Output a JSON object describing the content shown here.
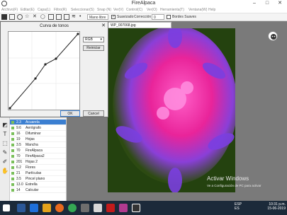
{
  "window": {
    "title": "FireAlpaca"
  },
  "menu": [
    "Archivo(F)",
    "Editar(E)",
    "Capa(L)",
    "Filtro(R)",
    "Seleccionar(S)",
    "Snap (N)",
    "Ver(V)",
    "Control(C)",
    "Ver(O)",
    "Herramienta(T)",
    "Ventana(W)",
    "Help"
  ],
  "toolbar": {
    "mode_label": "Mano libre",
    "smooth_label": "Suavizado",
    "correction_label": "Corrección",
    "correction_value": "0",
    "soft_edges_label": "Bordes Suaves"
  },
  "document": {
    "tab_name": "WP_007068.jpg"
  },
  "dialog": {
    "title": "Curva de tonos",
    "channel": "RGB",
    "reset_label": "Reiniciar",
    "ok_label": "OK",
    "cancel_label": "Cancel"
  },
  "brushes": [
    {
      "size": "2.3",
      "name": "Acuarela"
    },
    {
      "size": "9.6",
      "name": "Aerógrafo"
    },
    {
      "size": "16",
      "name": "Difuminar"
    },
    {
      "size": "19",
      "name": "Hojas"
    },
    {
      "size": "3.5",
      "name": "Mancha"
    },
    {
      "size": "70",
      "name": "FireAlpaca"
    },
    {
      "size": "70",
      "name": "FireAlpaca2"
    },
    {
      "size": "201",
      "name": "Hojas 2"
    },
    {
      "size": "6.2",
      "name": "Flores"
    },
    {
      "size": "21",
      "name": "Partículas"
    },
    {
      "size": "3.5",
      "name": "Pincel plano"
    },
    {
      "size": "13.0",
      "name": "Estrella"
    },
    {
      "size": "14",
      "name": "Calcular"
    }
  ],
  "watermark": {
    "line1": "Activar Windows",
    "line2": "Ve a Configuración de PC para activar"
  },
  "taskbar": {
    "lang": "ESP",
    "region": "ES",
    "time": "10:31 p.m.",
    "date": "15-06-2019"
  },
  "colors": {
    "accent": "#3b7fd1",
    "taskbar": "#1c2a3a"
  }
}
